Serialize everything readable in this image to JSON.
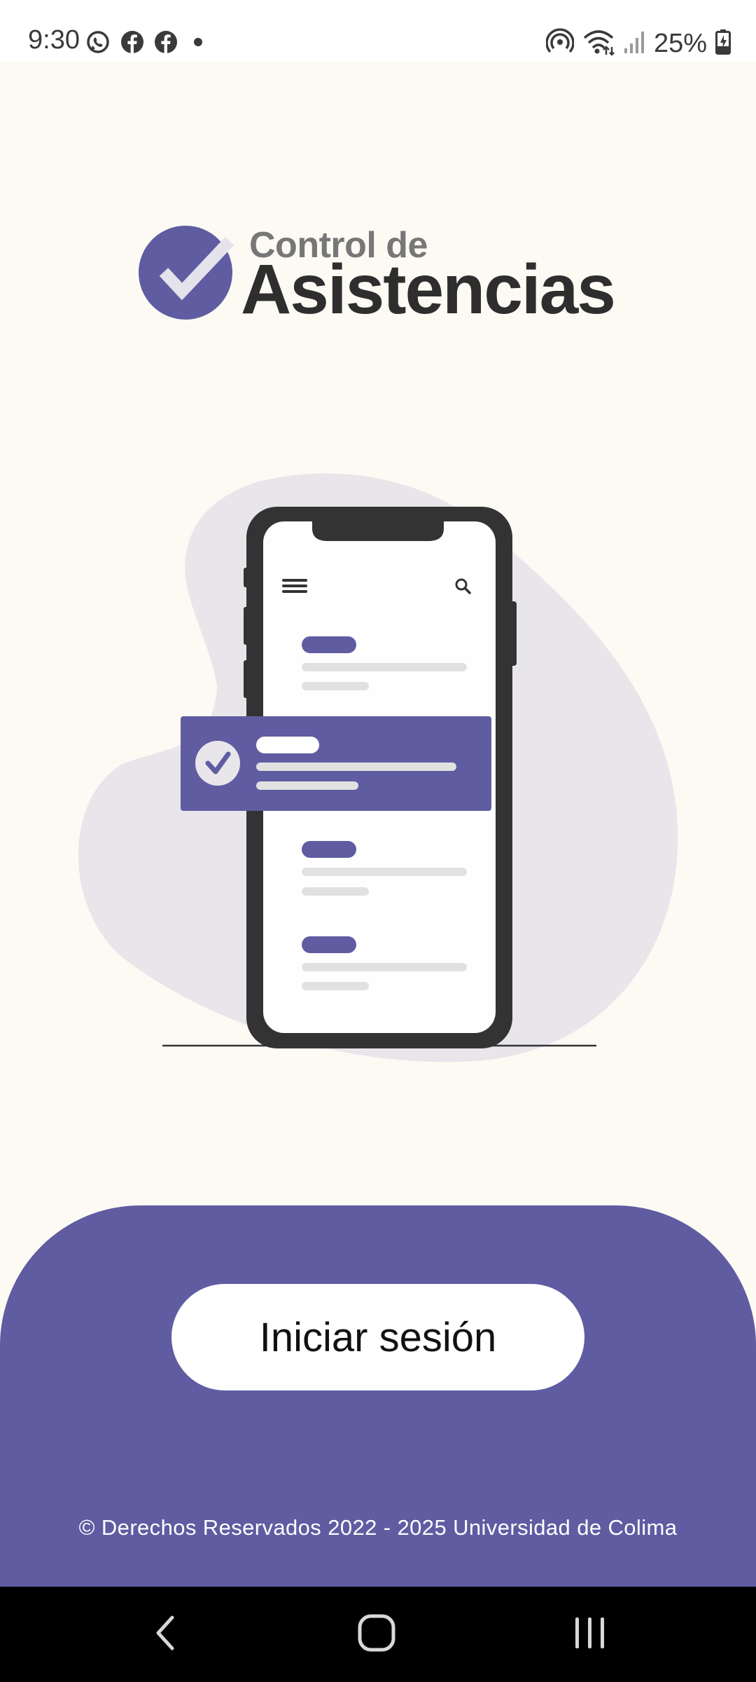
{
  "status_bar": {
    "time": "9:30",
    "battery": "25%",
    "left_icons": [
      "whatsapp-icon",
      "facebook-icon",
      "facebook-icon",
      "dot-icon"
    ],
    "right_icons": [
      "hotspot-icon",
      "wifi-icon",
      "signal-icon",
      "battery-icon"
    ]
  },
  "logo": {
    "line1": "Control de",
    "line2": "Asistencias"
  },
  "main": {
    "login_label": "Iniciar sesión"
  },
  "footer": {
    "copyright": "© Derechos Reservados 2022 - 2025 Universidad de Colima"
  },
  "nav_bar": {
    "items": [
      "back-icon",
      "home-icon",
      "recents-icon"
    ]
  },
  "colors": {
    "accent": "#5f5ca2",
    "background": "#fdfaf4",
    "blob": "#e8e6ea",
    "phone": "#333333"
  }
}
